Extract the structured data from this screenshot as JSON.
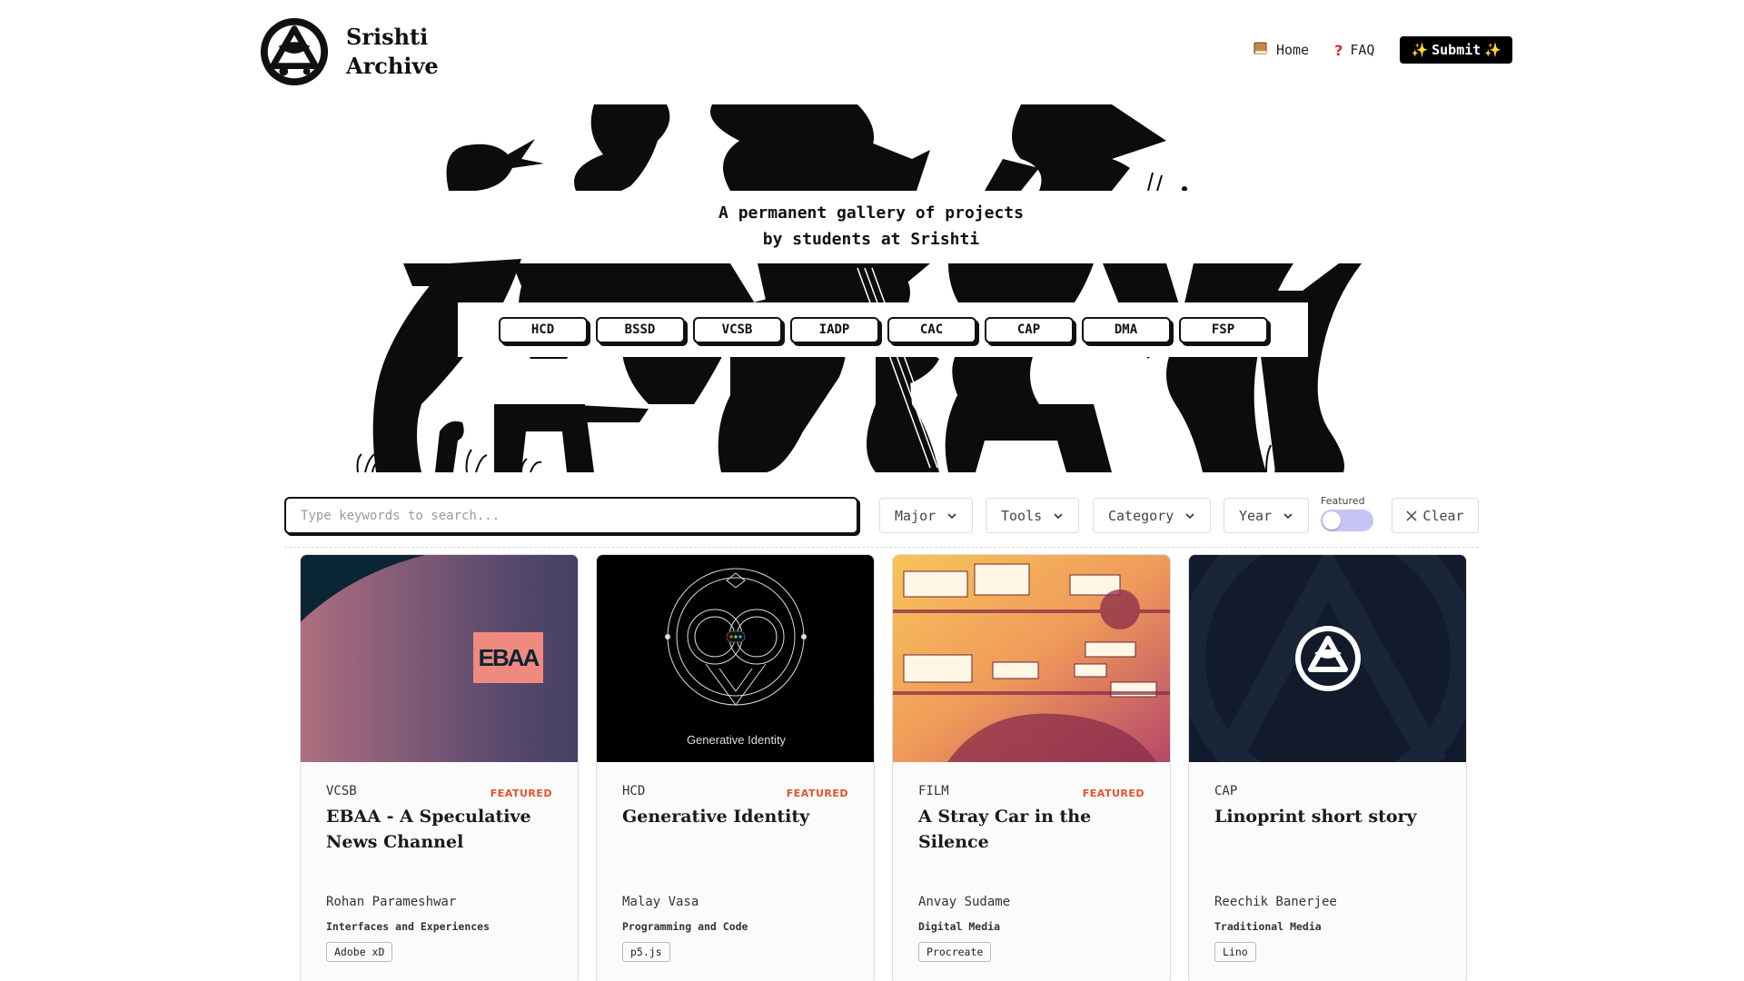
{
  "site": {
    "brand_line1": "Srishti",
    "brand_line2": "Archive"
  },
  "nav": {
    "home_icon": "book-icon",
    "home_label": "Home",
    "faq_icon": "question-icon",
    "faq_label": "FAQ",
    "submit_label": "Submit",
    "submit_icon": "sparkles-icon"
  },
  "hero": {
    "tagline_line1": "A permanent gallery of projects",
    "tagline_line2": "by students at Srishti",
    "majors": [
      "HCD",
      "BSSD",
      "VCSB",
      "IADP",
      "CAC",
      "CAP",
      "DMA",
      "FSP"
    ]
  },
  "filters": {
    "search_placeholder": "Type keywords to search...",
    "search_value": "",
    "major_label": "Major",
    "tools_label": "Tools",
    "category_label": "Category",
    "year_label": "Year",
    "featured_label": "Featured",
    "featured_on": false,
    "clear_label": "Clear"
  },
  "projects": [
    {
      "major": "VCSB",
      "featured": "FEATURED",
      "title": "EBAA - A Speculative News Channel",
      "author": "Rohan Parameshwar",
      "category": "Interfaces and Experiences",
      "tool": "Adobe xD",
      "thumb_text": "EBAA",
      "accent": "#f08a7e"
    },
    {
      "major": "HCD",
      "featured": "FEATURED",
      "title": "Generative Identity",
      "author": "Malay Vasa",
      "category": "Programming and Code",
      "tool": "p5.js",
      "thumb_text": "Generative Identity"
    },
    {
      "major": "FILM",
      "featured": "FEATURED",
      "title": "A Stray Car in the Silence",
      "author": "Anvay Sudame",
      "category": "Digital Media",
      "tool": "Procreate"
    },
    {
      "major": "CAP",
      "featured": "",
      "title": "Linoprint short story",
      "author": "Reechik Banerjee",
      "category": "Traditional Media",
      "tool": "Lino"
    }
  ],
  "colors": {
    "featured": "#e0532b",
    "toggle_track": "#c7c3f5",
    "card_dark": "#111b2b"
  }
}
